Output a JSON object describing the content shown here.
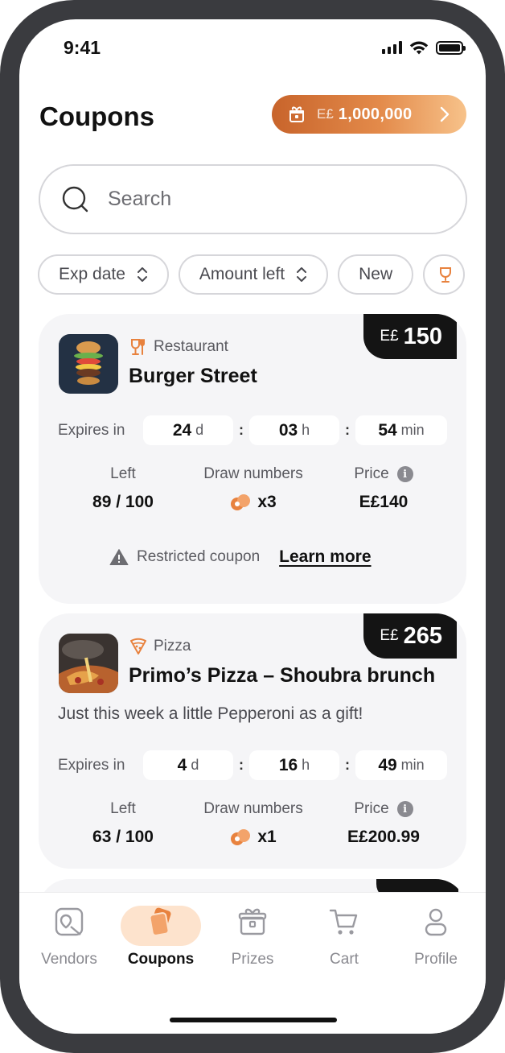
{
  "status_bar": {
    "time": "9:41"
  },
  "header": {
    "title": "Coupons",
    "balance": {
      "currency": "E£",
      "amount": "1,000,000"
    }
  },
  "search": {
    "placeholder": "Search",
    "value": ""
  },
  "filters": [
    {
      "label": "Exp date",
      "icon": "sort-icon"
    },
    {
      "label": "Amount left",
      "icon": "sort-icon"
    },
    {
      "label": "New",
      "icon": ""
    },
    {
      "label": "",
      "icon": "trophy-icon"
    }
  ],
  "coupons": [
    {
      "category": "Restaurant",
      "category_icon": "restaurant-icon",
      "vendor": "Burger Street",
      "description": "",
      "badge": {
        "currency": "E£",
        "value": "150"
      },
      "expires_label": "Expires in",
      "days": "24",
      "days_unit": "d",
      "hours": "03",
      "hours_unit": "h",
      "minutes": "54",
      "minutes_unit": "min",
      "left_label": "Left",
      "left_value": "89 / 100",
      "draw_label": "Draw numbers",
      "draw_value": "x3",
      "price_label": "Price",
      "price_value": "E£140",
      "restricted_text": "Restricted coupon",
      "learn_more": "Learn more"
    },
    {
      "category": "Pizza",
      "category_icon": "pizza-icon",
      "vendor": "Primo’s Pizza – Shoubra brunch",
      "description": "Just this week a little Pepperoni as a gift!",
      "badge": {
        "currency": "E£",
        "value": "265"
      },
      "expires_label": "Expires in",
      "days": "4",
      "days_unit": "d",
      "hours": "16",
      "hours_unit": "h",
      "minutes": "49",
      "minutes_unit": "min",
      "left_label": "Left",
      "left_value": "63 / 100",
      "draw_label": "Draw numbers",
      "draw_value": "x1",
      "price_label": "Price",
      "price_value": "E£200.99"
    }
  ],
  "tabs": [
    {
      "label": "Vendors",
      "icon": "vendors-icon",
      "active": false
    },
    {
      "label": "Coupons",
      "icon": "coupons-icon",
      "active": true
    },
    {
      "label": "Prizes",
      "icon": "prizes-icon",
      "active": false
    },
    {
      "label": "Cart",
      "icon": "cart-icon",
      "active": false
    },
    {
      "label": "Profile",
      "icon": "profile-icon",
      "active": false
    }
  ],
  "colors": {
    "accent": "#E8823E",
    "accent_light": "#FDE3CD",
    "card_bg": "#F5F5F7",
    "badge_bg": "#141414"
  }
}
